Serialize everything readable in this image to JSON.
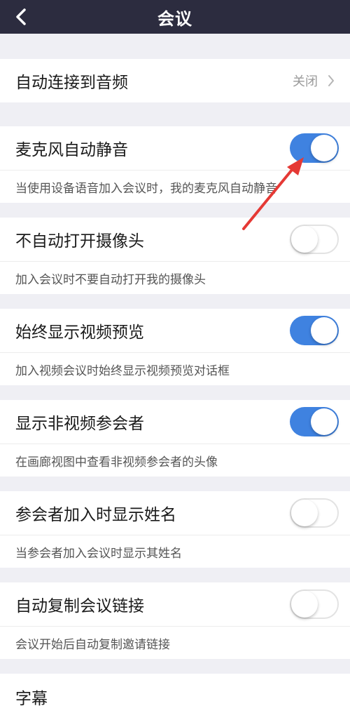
{
  "header": {
    "title": "会议"
  },
  "settings": [
    {
      "label": "自动连接到音频",
      "value": "关闭"
    },
    {
      "label": "麦克风自动静音",
      "toggle": "on",
      "desc": "当使用设备语音加入会议时，我的麦克风自动静音"
    },
    {
      "label": "不自动打开摄像头",
      "toggle": "off",
      "desc": "加入会议时不要自动打开我的摄像头"
    },
    {
      "label": "始终显示视频预览",
      "toggle": "on",
      "desc": "加入视频会议时始终显示视频预览对话框"
    },
    {
      "label": "显示非视频参会者",
      "toggle": "on",
      "desc": "在画廊视图中查看非视频参会者的头像"
    },
    {
      "label": "参会者加入时显示姓名",
      "toggle": "off",
      "desc": "当参会者加入会议时显示其姓名"
    },
    {
      "label": "自动复制会议链接",
      "toggle": "off",
      "desc": "会议开始后自动复制邀请链接"
    },
    {
      "label": "字幕"
    }
  ],
  "colors": {
    "header_bg": "#2c2c3f",
    "toggle_on": "#3f82e0",
    "arrow": "#e53935"
  }
}
